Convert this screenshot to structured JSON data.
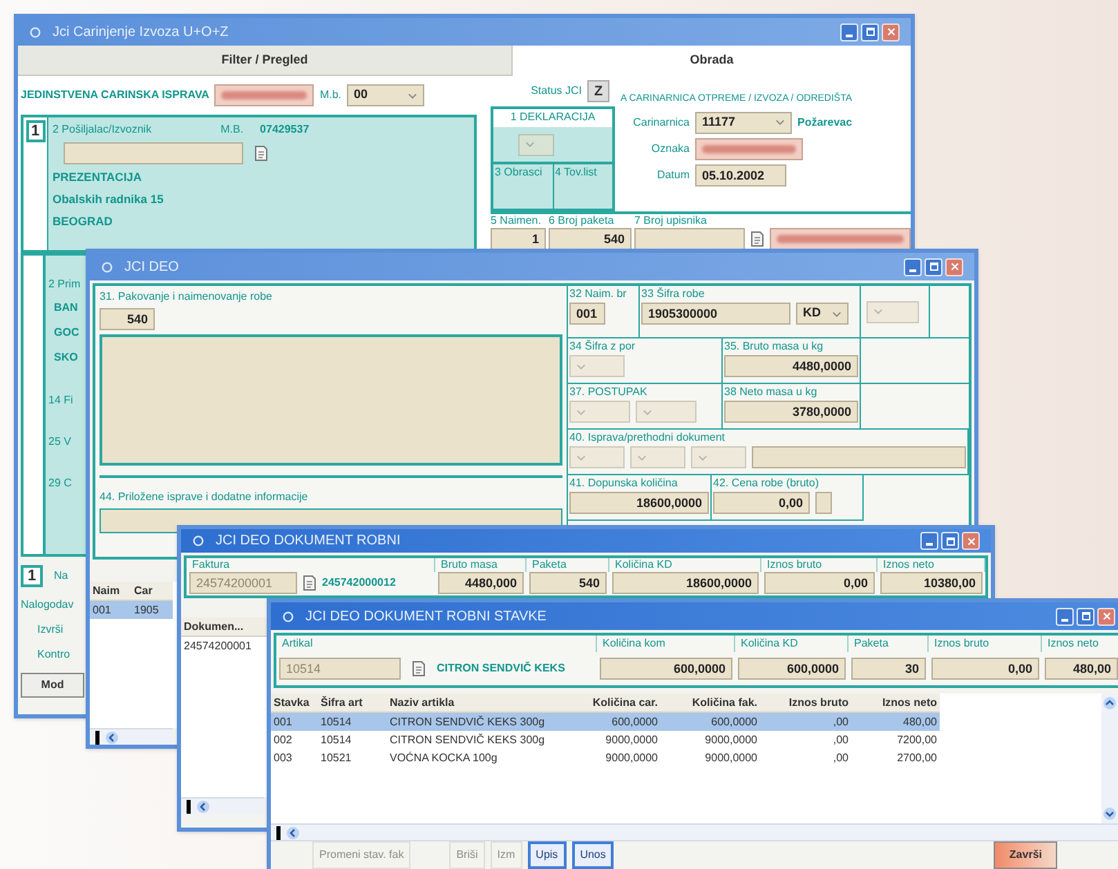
{
  "main_window": {
    "title": "Jci Carinjenje Izvoza U+O+Z",
    "tabs": [
      {
        "label": "Filter / Pregled",
        "selected": false
      },
      {
        "label": "Obrada",
        "selected": true
      }
    ],
    "document_label": "JEDINSTVENA CARINSKA ISPRAVA",
    "mb_label": "M.b.",
    "mb_value": "00",
    "status_label": "Status JCI",
    "status_value": "Z",
    "declaration_label": "1 DEKLARACIJA",
    "office_heading": "A CARINARNICA OTPREME / IZVOZA / ODREDIŠTA",
    "office_fields": [
      {
        "label": "Carinarnica",
        "value": "11177",
        "kind": "dropdown",
        "note": "Požarevac"
      },
      {
        "label": "Oznaka",
        "kind": "redacted"
      },
      {
        "label": "Datum",
        "value": "05.10.2002",
        "kind": "text"
      }
    ],
    "section_number": "1",
    "sender_label": "2 Pošiljalac/Izvoznik",
    "id_label": "M.B.",
    "id_value": "07429537",
    "sender_lines": [
      "PREZENTACIJA",
      "Obalskih radnika 15",
      "BEOGRAD"
    ],
    "boxes": [
      "3 Obrasci",
      "4 Tov.list"
    ],
    "counts": [
      {
        "label": "5 Naimen.",
        "value": "1",
        "kind": "text"
      },
      {
        "label": "6 Broj paketa",
        "value": "540",
        "kind": "text"
      },
      {
        "label": "7 Broj upisnika",
        "kind": "disabled"
      }
    ],
    "side_cells": [
      {
        "text": "2 Prim",
        "kind": "label"
      },
      {
        "text": "BAN",
        "kind": "value"
      },
      {
        "text": "GOC",
        "kind": "value"
      },
      {
        "text": "SKO",
        "kind": "value"
      },
      {
        "text": "14 Fi",
        "kind": "label"
      },
      {
        "text": "25 V",
        "kind": "label"
      },
      {
        "text": "29 C",
        "kind": "label"
      }
    ],
    "footer_number": "1",
    "footer_tag": "Na",
    "footer_labels": [
      "Nalogodav",
      "Izvrši",
      "Kontro"
    ],
    "mod_button": "Mod"
  },
  "part_window": {
    "title": "JCI DEO",
    "packing_label": "31. Pakovanje i naimenovanje robe",
    "packing_value": "540",
    "item_no_label": "32 Naim. br",
    "item_no": "001",
    "code_label": "33 Šifra robe",
    "code_value": "1905300000",
    "code_unit": "KD",
    "tax_code_label": "34 Šifra z por",
    "gross_label": "35. Bruto masa u kg",
    "gross_value": "4480,0000",
    "procedure_label": "37. POSTUPAK",
    "net_label": "38 Neto masa u kg",
    "net_value": "3780,0000",
    "prev_doc_label": "40. Isprava/prethodni dokument",
    "extra_qty_label": "41. Dopunska količina",
    "extra_qty_value": "18600,0000",
    "price_label": "42. Cena robe (bruto)",
    "price_value": "0,00",
    "attached_label": "44. Priložene isprave i dodatne informacije",
    "table": {
      "columns": [
        "Naim",
        "Car"
      ],
      "rows": [
        {
          "cells": [
            "001",
            "1905"
          ],
          "selected": true
        }
      ]
    }
  },
  "document_window": {
    "title": "JCI DEO DOKUMENT ROBNI",
    "columns": [
      "Faktura",
      "Bruto masa",
      "Paketa",
      "Količina KD",
      "Iznos bruto",
      "Iznos neto"
    ],
    "invoice_disabled": "24574200001",
    "invoice": "245742000012",
    "values": [
      "4480,000",
      "540",
      "18600,0000",
      "0,00",
      "10380,00"
    ],
    "table": {
      "columns": [
        "Dokumen..."
      ],
      "rows": [
        {
          "cells": [
            "24574200001"
          ],
          "selected": false
        }
      ]
    }
  },
  "items_window": {
    "title": "JCI DEO DOKUMENT ROBNI STAVKE",
    "columns": [
      "Artikal",
      "Količina kom",
      "Količina KD",
      "Paketa",
      "Iznos bruto",
      "Iznos neto"
    ],
    "article_code": "10514",
    "article_name": "CITRON SENDVIČ KEKS",
    "values": [
      "600,0000",
      "600,0000",
      "30",
      "0,00",
      "480,00"
    ],
    "table": {
      "columns": [
        "Stavka",
        "Šifra art",
        "Naziv artikla",
        "Količina car.",
        "Količina fak.",
        "Iznos bruto",
        "Iznos neto"
      ],
      "rows": [
        {
          "cells": [
            "001",
            "10514",
            "CITRON SENDVIČ KEKS 300g",
            "600,0000",
            "600,0000",
            ",00",
            "480,00"
          ],
          "selected": true
        },
        {
          "cells": [
            "002",
            "10514",
            "CITRON SENDVIČ KEKS 300g",
            "9000,0000",
            "9000,0000",
            ",00",
            "7200,00"
          ],
          "selected": false
        },
        {
          "cells": [
            "003",
            "10521",
            "VOĆNA KOCKA 100g",
            "9000,0000",
            "9000,0000",
            ",00",
            "2700,00"
          ],
          "selected": false
        }
      ]
    },
    "buttons": [
      {
        "label": "Promeni stav. fak",
        "disabled": true
      },
      {
        "label": "Briši",
        "disabled": true
      },
      {
        "label": "Izm",
        "disabled": true
      },
      {
        "label": "Upis",
        "disabled": false
      },
      {
        "label": "Unos",
        "disabled": false
      }
    ],
    "close_button": "Završi"
  }
}
